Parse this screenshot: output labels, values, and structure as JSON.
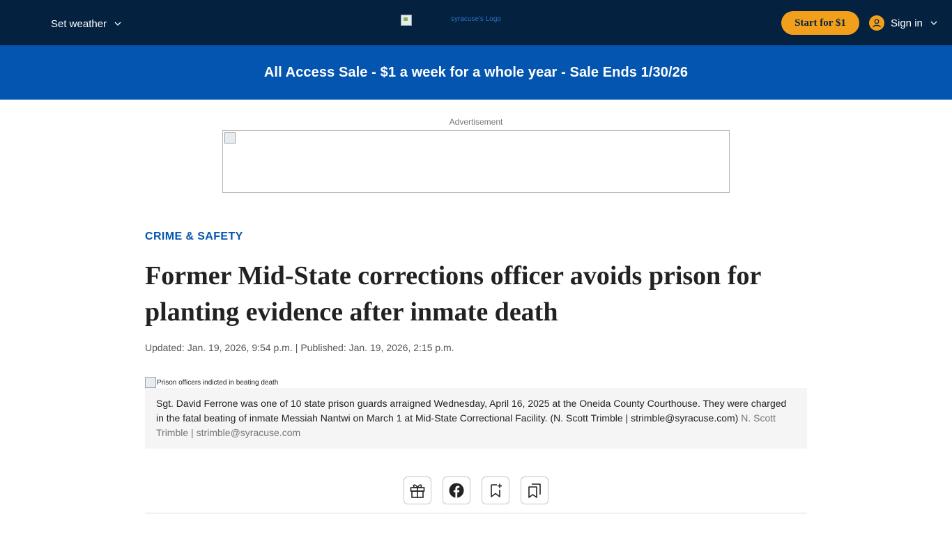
{
  "header": {
    "weather_label": "Set weather",
    "logo_alt": "syracuse's Logo",
    "start_button": "Start for $1",
    "signin_label": "Sign in"
  },
  "promo": {
    "text": "All Access Sale - $1 a week for a whole year - Sale Ends 1/30/26"
  },
  "ad": {
    "label": "Advertisement"
  },
  "article": {
    "section": "CRIME & SAFETY",
    "headline": "Former Mid-State corrections officer avoids prison for planting evidence after inmate death",
    "updated": "Updated: Jan. 19, 2026, 9:54 p.m.",
    "separator": "|",
    "published": "Published: Jan. 19, 2026, 2:15 p.m.",
    "photo_alt": "Prison officers indicted in beating death",
    "caption": "Sgt. David Ferrone was one of 10 state prison guards arraigned Wednesday, April 16, 2025 at the Oneida County Courthouse. They were charged in the fatal beating of inmate Messiah Nantwi on March 1 at Mid-State Correctional Facility. (N. Scott Trimble | strimble@syracuse.com)",
    "credit": "N. Scott Trimble | strimble@syracuse.com"
  },
  "tools": [
    {
      "icon": "gift-icon"
    },
    {
      "icon": "facebook-icon"
    },
    {
      "icon": "bookmark-add-icon"
    },
    {
      "icon": "saved-bookmarks-icon"
    }
  ],
  "colors": {
    "nav_bg": "#04213f",
    "promo_bg": "#0455b0",
    "accent": "#f2a01c",
    "section_link": "#0455b0"
  }
}
